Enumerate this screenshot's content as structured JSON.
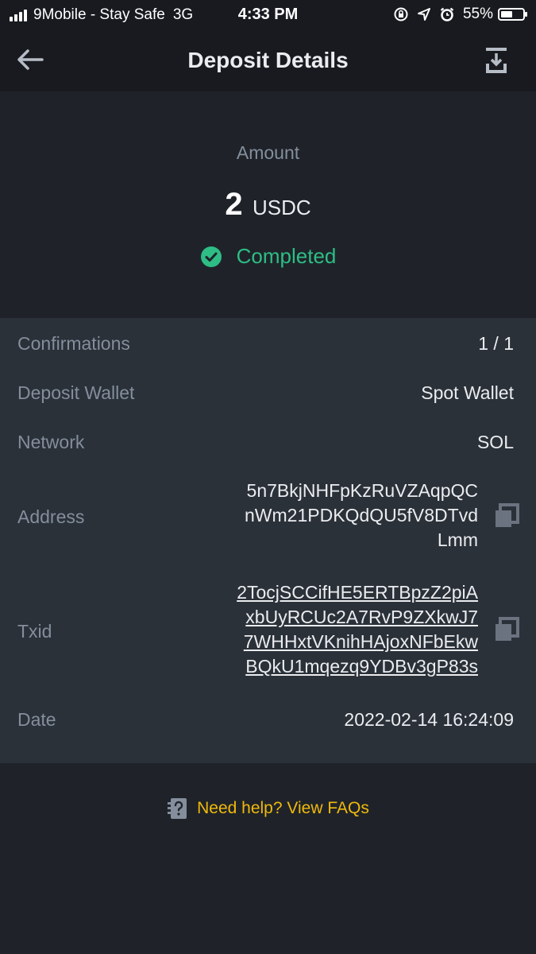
{
  "status_bar": {
    "carrier": "9Mobile - Stay Safe",
    "network": "3G",
    "time": "4:33 PM",
    "battery": "55%",
    "battery_level": 0.55
  },
  "header": {
    "title": "Deposit Details",
    "back_icon": "arrow-left-icon",
    "download_icon": "download-icon"
  },
  "summary": {
    "amount_label": "Amount",
    "amount_value": "2",
    "amount_unit": "USDC",
    "status": "Completed",
    "status_color": "#2ebd85"
  },
  "details": {
    "confirmations": {
      "label": "Confirmations",
      "value": "1 / 1"
    },
    "deposit_wallet": {
      "label": "Deposit Wallet",
      "value": "Spot Wallet"
    },
    "network": {
      "label": "Network",
      "value": "SOL"
    },
    "address": {
      "label": "Address",
      "lines": [
        "5n7BkjNHFpKzRuVZAqpQC",
        "nWm21PDKQdQU5fV8DTvd",
        "Lmm"
      ]
    },
    "txid": {
      "label": "Txid",
      "lines": [
        "2TocjSCCifHE5ERTBpzZ2piA",
        "xbUyRCUc2A7RvP9ZXkwJ7",
        "7WHHxtVKnihHAjoxNFbEkw",
        "BQkU1mqezq9YDBv3gP83s"
      ]
    },
    "date": {
      "label": "Date",
      "value": "2022-02-14 16:24:09"
    }
  },
  "help": {
    "text": "Need help? View FAQs",
    "color": "#f0b90b"
  }
}
